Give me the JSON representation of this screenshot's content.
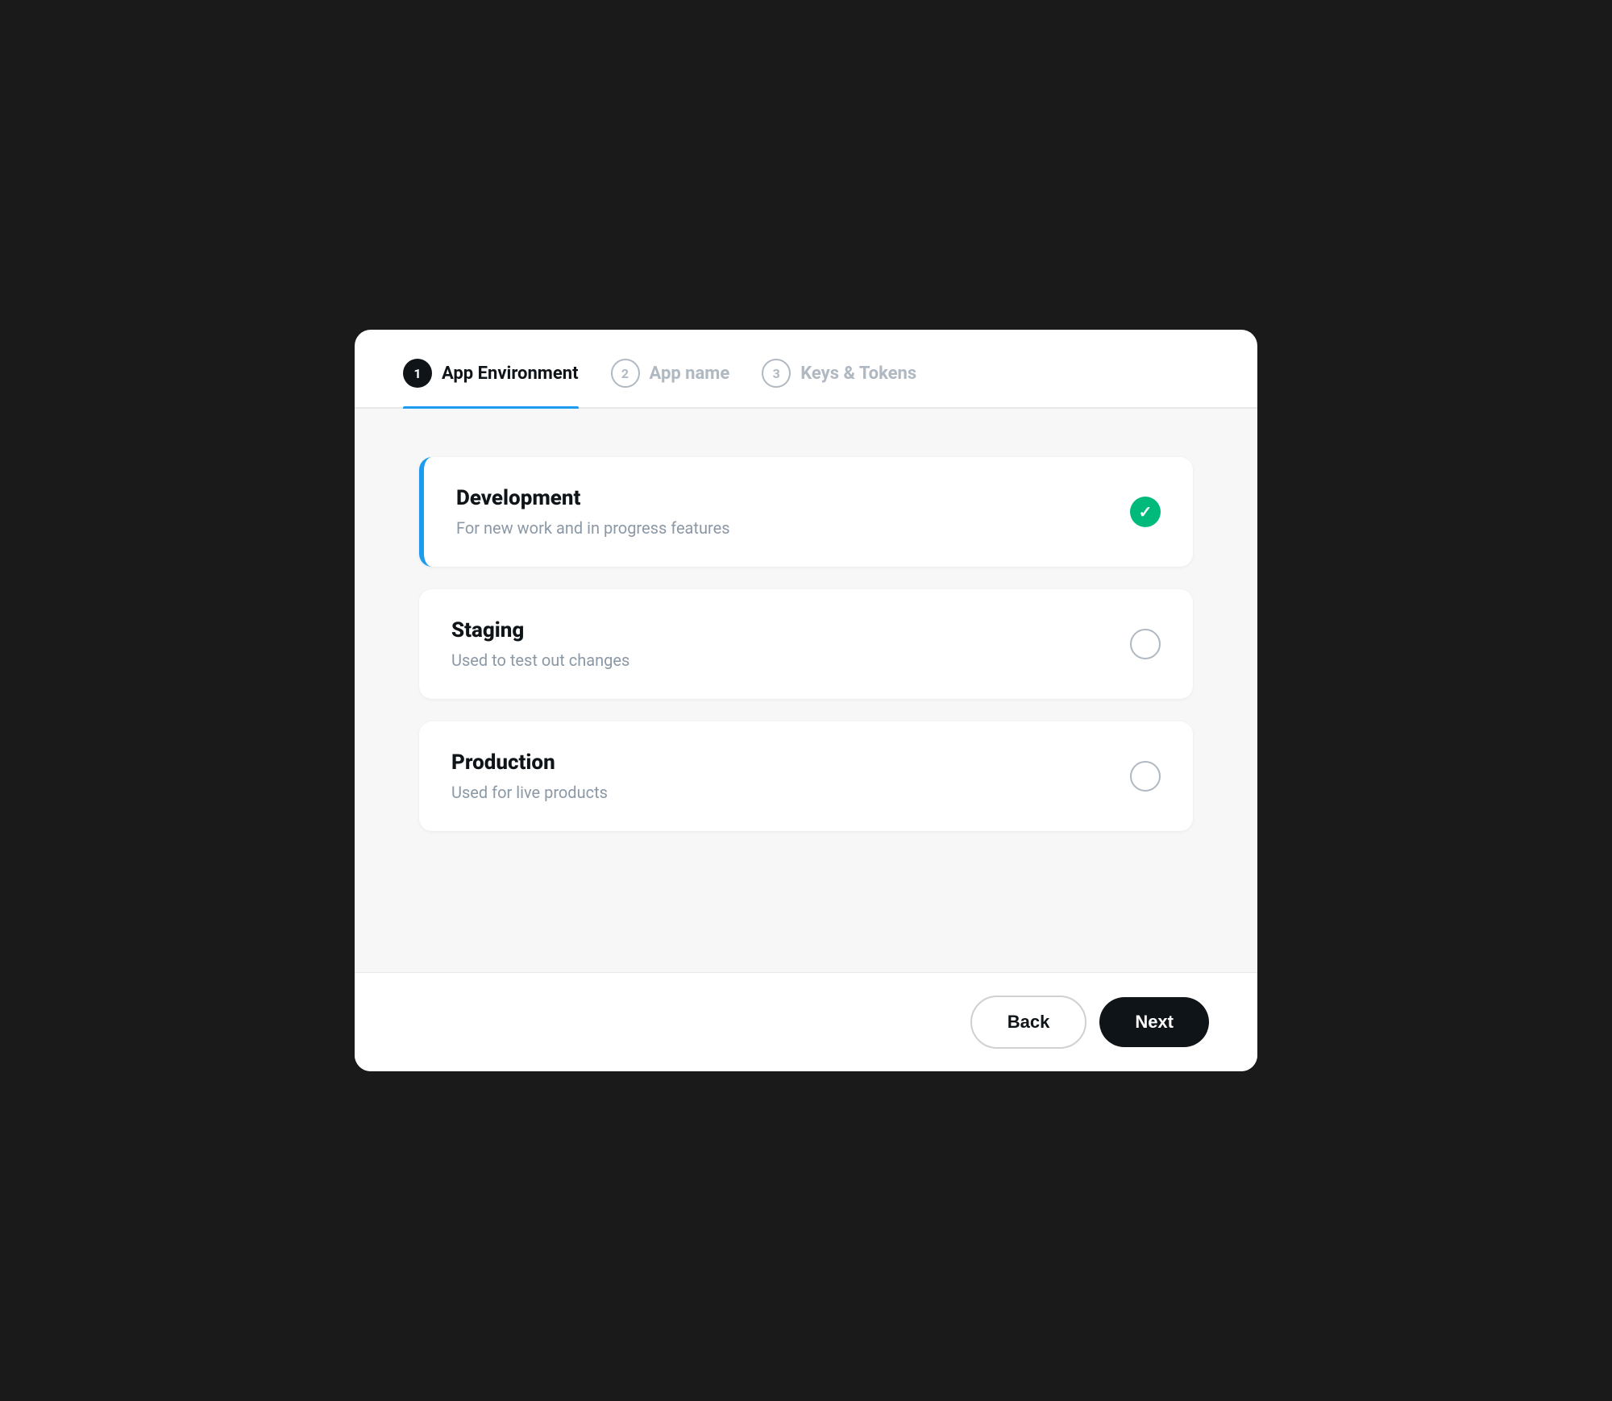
{
  "tabs": [
    {
      "id": "tab-1",
      "number": "1",
      "label": "App Environment",
      "active": true
    },
    {
      "id": "tab-2",
      "number": "2",
      "label": "App name",
      "active": false
    },
    {
      "id": "tab-3",
      "number": "3",
      "label": "Keys & Tokens",
      "active": false
    }
  ],
  "options": [
    {
      "id": "development",
      "title": "Development",
      "description": "For new work and in progress features",
      "selected": true
    },
    {
      "id": "staging",
      "title": "Staging",
      "description": "Used to test out changes",
      "selected": false
    },
    {
      "id": "production",
      "title": "Production",
      "description": "Used for live products",
      "selected": false
    }
  ],
  "buttons": {
    "back": "Back",
    "next": "Next"
  },
  "colors": {
    "active_tab_indicator": "#1d9bf0",
    "selected_border": "#1d9bf0",
    "checked_bg": "#00ba7c",
    "next_bg": "#0f1419"
  }
}
